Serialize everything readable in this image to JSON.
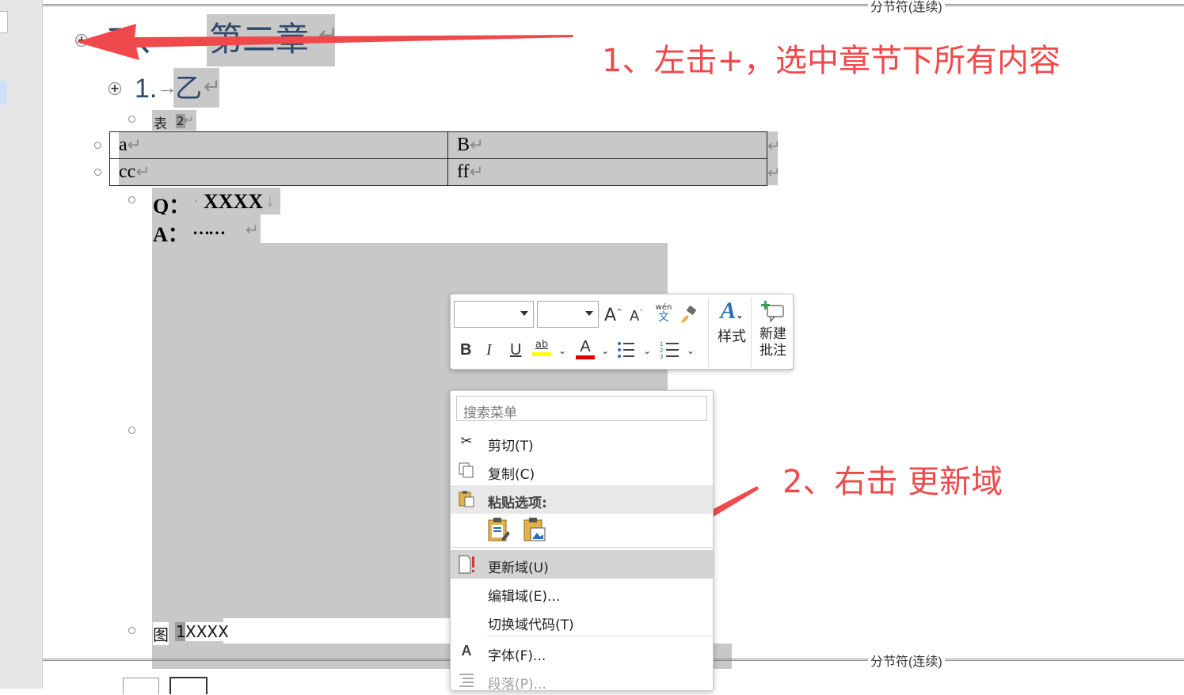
{
  "document": {
    "section_break_top": "分节符(连续)",
    "section_break_bottom": "分节符(连续)",
    "heading1": {
      "number": "二、",
      "title": "第二章"
    },
    "heading2": {
      "number": "1.",
      "title": "乙"
    },
    "table_caption": {
      "label": "表",
      "number": "2"
    },
    "table": [
      [
        "a",
        "B"
      ],
      [
        "cc",
        "ff"
      ]
    ],
    "q_label": "Q：",
    "q_text": "XXXX",
    "a_label": "A：",
    "a_text": "……",
    "figure_caption": {
      "label": "图",
      "number": "1",
      "text": "XXXX"
    }
  },
  "annotations": {
    "step1": "1、左击+，选中章节下所有内容",
    "step2": "2、右击 更新域"
  },
  "mini_toolbar": {
    "font_name": "",
    "font_size": "",
    "grow_font": "A",
    "shrink_font": "A",
    "phonetic_top": "wén",
    "phonetic_bottom": "文",
    "bold": "B",
    "italic": "I",
    "underline": "U",
    "highlight_glyph": "ab",
    "font_color_glyph": "A",
    "styles_label": "样式",
    "new_comment_label_1": "新建",
    "new_comment_label_2": "批注",
    "highlight_color": "#ffff00",
    "font_color": "#e00000"
  },
  "context_menu": {
    "search_placeholder": "搜索菜单",
    "items": {
      "cut": "剪切(T)",
      "copy": "复制(C)",
      "paste_options": "粘贴选项:",
      "update_field": "更新域(U)",
      "edit_field": "编辑域(E)...",
      "toggle_field_codes": "切换域代码(T)",
      "font": "字体(F)...",
      "paragraph": "段落(P)..."
    }
  },
  "colors": {
    "annotation": "#f0494b",
    "selection": "#c8c8c8"
  }
}
